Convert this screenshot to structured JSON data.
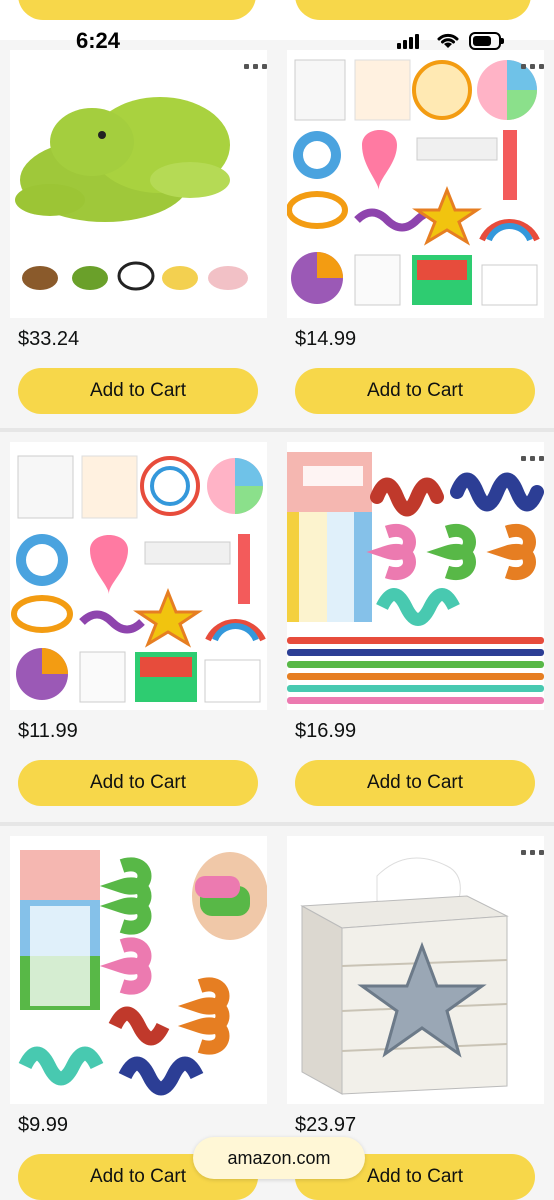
{
  "status_bar": {
    "time": "6:24"
  },
  "browser": {
    "url": "amazon.com"
  },
  "products": [
    {
      "price": "$33.24",
      "button": "Add to Cart",
      "image": "green plush turtle toy with mini animal plush variants"
    },
    {
      "price": "$14.99",
      "button": "Add to Cart",
      "image": "calming strategy posters and stickers set"
    },
    {
      "price": "$11.99",
      "button": "Add to Cart",
      "image": "calming strategy posters and stickers set"
    },
    {
      "price": "$16.99",
      "button": "Add to Cart",
      "image": "sensory fidget tubes with box"
    },
    {
      "price": "$9.99",
      "button": "Add to Cart",
      "image": "sensory fidget tubes with hand demo"
    },
    {
      "price": "$23.97",
      "button": "Add to Cart",
      "image": "whitewashed wooden tissue box with starfish"
    }
  ],
  "colors": {
    "button_yellow": "#f7d74a",
    "card_bg": "#f5f5f5"
  }
}
